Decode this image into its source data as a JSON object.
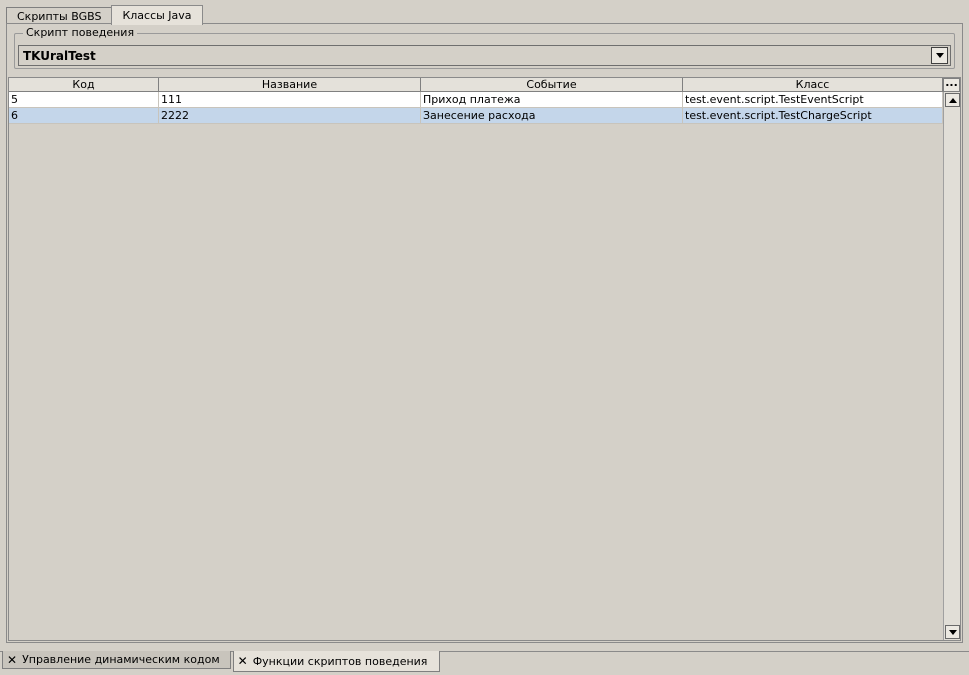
{
  "tabs": [
    {
      "label": "Скрипты BGBS",
      "active": false
    },
    {
      "label": "Классы Java",
      "active": true
    }
  ],
  "group": {
    "title": "Скрипт поведения",
    "combo_value": "TKUralTest"
  },
  "table": {
    "columns": [
      "Код",
      "Название",
      "Событие",
      "Класс"
    ],
    "corner_label": "...",
    "rows": [
      {
        "cells": [
          "5",
          "111",
          "Приход платежа",
          "test.event.script.TestEventScript"
        ],
        "selected": false
      },
      {
        "cells": [
          "6",
          "2222",
          "Занесение расхода",
          "test.event.script.TestChargeScript"
        ],
        "selected": true
      }
    ]
  },
  "bottom_tabs": [
    {
      "label": "Управление динамическим кодом",
      "icon": "close-icon",
      "active": false
    },
    {
      "label": "Функции скриптов поведения",
      "icon": "close-icon",
      "active": true
    }
  ],
  "icons": {
    "close": "✕"
  }
}
